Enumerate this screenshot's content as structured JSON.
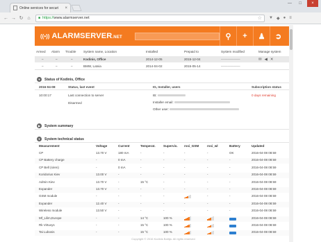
{
  "browser": {
    "tab_title": "Online services for securi",
    "tab_close": "×",
    "url_scheme": "https://",
    "url_host": "www.alarmserver.net",
    "minimize": "—",
    "maximize": "□",
    "close": "×"
  },
  "app": {
    "logo_mark": "((•))",
    "logo_name": "ALARMSERVER",
    "logo_tld": ".NET",
    "brand_color": "#f47b20",
    "header_icons": [
      "search-icon",
      "plus-icon",
      "user-icon",
      "logout-icon"
    ]
  },
  "systems": {
    "headers": [
      "Armed",
      "Alarm",
      "Trouble",
      "System name, Location",
      "Installed",
      "Prepaid to",
      "System modified",
      "Manage system"
    ],
    "rows": [
      {
        "armed": "–",
        "alarm": "–",
        "trouble": "–",
        "name": "Kodinis, Office",
        "installed": "2014-12-05",
        "prepaid": "2015-12-04",
        "modified": "——————",
        "manage": [
          "✉",
          "◀",
          "✕"
        ]
      },
      {
        "armed": "–",
        "alarm": "–",
        "trouble": "–",
        "name": "BMW, Latvia",
        "installed": "2014-04-02",
        "prepaid": "2015-05-14",
        "modified": "——————",
        "manage": []
      }
    ]
  },
  "status": {
    "title": "Status of Kodinis, Office",
    "headers": {
      "date": "2016-04-08",
      "status": "Status, last event",
      "installer": "IG, Installer, users",
      "subscription": "Subscription status"
    },
    "time": "10:00:17",
    "last_connection": "Last connection to server",
    "disarmed": "Disarmed",
    "installer_label": "IB:",
    "installer_email": "Installer email:",
    "other_user": "Other user:",
    "subscription_value": "0 days remaining"
  },
  "summary": {
    "title": "System summary"
  },
  "technical": {
    "title": "System technical status",
    "headers": [
      "Measurement",
      "Voltage",
      "Current",
      "Temperat.",
      "Supervis.",
      "rssi_GSM",
      "rssi_wl",
      "Battery",
      "Updated"
    ],
    "rows": [
      {
        "m": "CP",
        "v": "13.70 V",
        "c": "180 mA",
        "t": "-",
        "s": "-",
        "gsm": null,
        "wl": "-",
        "b": "OK",
        "u": "2016-04-08 08:59"
      },
      {
        "m": "CP Battery charge",
        "v": "-",
        "c": "0 mA",
        "t": "-",
        "s": "-",
        "gsm": null,
        "wl": "-",
        "b": "-",
        "u": "2016-04-08 08:59"
      },
      {
        "m": "CP Bell (siren)",
        "v": "-",
        "c": "0 mA",
        "t": "-",
        "s": "-",
        "gsm": null,
        "wl": "-",
        "b": "-",
        "u": "2016-04-08 08:59"
      },
      {
        "m": "Koridorius Kiev",
        "v": "13.00 V",
        "c": "-",
        "t": "-",
        "s": "-",
        "gsm": null,
        "wl": "-",
        "b": "-",
        "u": "2016-04-08 08:59"
      },
      {
        "m": "Admin Kiev",
        "v": "13.70 V",
        "c": "-",
        "t": "15 °C",
        "s": "-",
        "gsm": null,
        "wl": "-",
        "b": "-",
        "u": "2016-04-08 08:59"
      },
      {
        "m": "Expander",
        "v": "13.70 V",
        "c": "-",
        "t": "-",
        "s": "-",
        "gsm": null,
        "wl": "-",
        "b": "-",
        "u": "2016-04-08 08:59"
      },
      {
        "m": "GSM module",
        "v": "-",
        "c": "-",
        "t": "-",
        "s": "-",
        "gsm": 3,
        "wl": "-",
        "b": "-",
        "u": "2016-04-08 08:59"
      },
      {
        "m": "Expander",
        "v": "12.40 V",
        "c": "-",
        "t": "-",
        "s": "-",
        "gsm": null,
        "wl": "-",
        "b": "-",
        "u": "2016-04-08 08:59"
      },
      {
        "m": "Wireless module",
        "v": "13.50 V",
        "c": "-",
        "t": "-",
        "s": "-",
        "gsm": null,
        "wl": "-",
        "b": "-",
        "u": "2016-04-08 08:59"
      },
      {
        "m": "Mf_Lilim,Europe",
        "v": "-",
        "c": "-",
        "t": "14 °C",
        "s": "100 %",
        "gsm": 4,
        "wl": 3,
        "b": "battery",
        "u": "2016-04-08 08:59"
      },
      {
        "m": "Rk Virtuvys",
        "v": "-",
        "c": "-",
        "t": "15 °C",
        "s": "100 %",
        "gsm": 4,
        "wl": 3,
        "b": "battery",
        "u": "2016-04-08 08:59"
      },
      {
        "m": "Tai Lubosis",
        "v": "-",
        "c": "-",
        "t": "15 °C",
        "s": "100 %",
        "gsm": 4,
        "wl": 3,
        "b": "battery",
        "u": "2016-04-08 08:59"
      }
    ]
  },
  "footer": "Copyright © 2016 Kodinis Baltija. All rights reserved"
}
